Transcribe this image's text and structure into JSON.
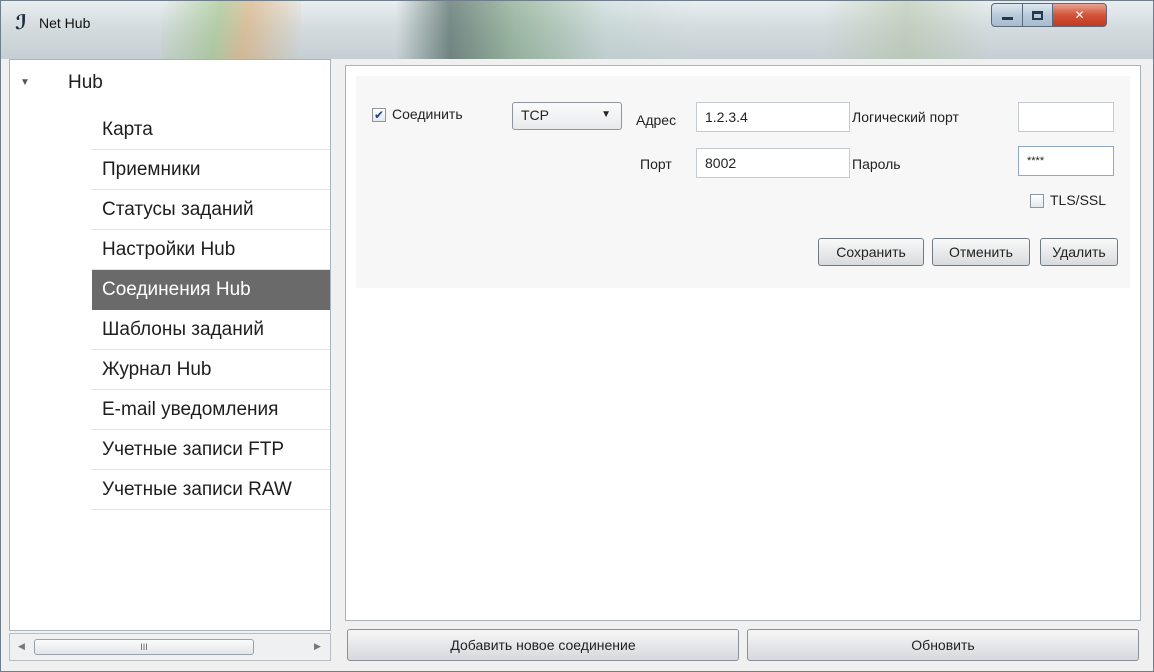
{
  "window": {
    "title": "Net Hub"
  },
  "tree": {
    "root_label": "Hub",
    "items": [
      {
        "label": "Карта"
      },
      {
        "label": "Приемники"
      },
      {
        "label": "Статусы заданий"
      },
      {
        "label": "Настройки Hub"
      },
      {
        "label": "Соединения Hub",
        "selected": true
      },
      {
        "label": "Шаблоны заданий"
      },
      {
        "label": "Журнал Hub"
      },
      {
        "label": "E-mail уведомления"
      },
      {
        "label": "Учетные записи FTP"
      },
      {
        "label": "Учетные записи RAW"
      }
    ],
    "scroll_thumb_label": "III"
  },
  "connection": {
    "connect_label": "Соединить",
    "connect_checked": true,
    "protocol_value": "TCP",
    "address_label": "Адрес",
    "address_value": "1.2.3.4",
    "port_label": "Порт",
    "port_value": "8002",
    "logical_port_label": "Логический порт",
    "logical_port_value": "",
    "password_label": "Пароль",
    "password_value": "****",
    "tls_label": "TLS/SSL",
    "tls_checked": false,
    "save_label": "Сохранить",
    "cancel_label": "Отменить",
    "delete_label": "Удалить"
  },
  "footer": {
    "add_label": "Добавить новое соединение",
    "refresh_label": "Обновить"
  },
  "colors": {
    "selected_item_bg": "#6a6a6a",
    "close_button": "#c23a22"
  }
}
